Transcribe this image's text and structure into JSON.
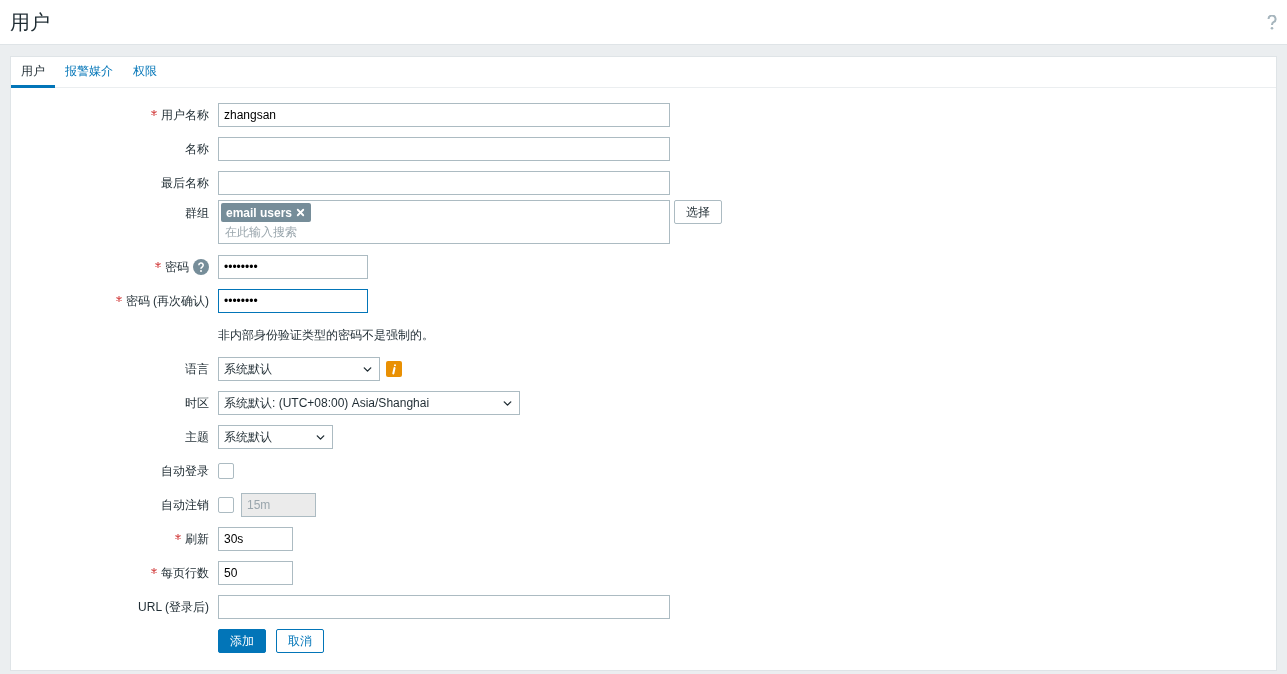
{
  "header": {
    "title": "用户"
  },
  "tabs": [
    {
      "label": "用户",
      "selected": true
    },
    {
      "label": "报警媒介",
      "selected": false
    },
    {
      "label": "权限",
      "selected": false
    }
  ],
  "form": {
    "rows": [
      {
        "kind": "text",
        "label": "用户名称",
        "required": true,
        "value": "zhangsan",
        "focused": false
      },
      {
        "kind": "text",
        "label": "名称",
        "required": false,
        "value": "",
        "focused": false
      },
      {
        "kind": "text",
        "label": "最后名称",
        "required": false,
        "value": "",
        "focused": false
      },
      {
        "kind": "multiselect",
        "label": "群组",
        "required": false,
        "tags": [
          "email users"
        ],
        "placeholder": "在此输入搜索",
        "button": "选择"
      },
      {
        "kind": "text",
        "label": "密码",
        "required": true,
        "value": "••••••••",
        "focused": false
      },
      {
        "kind": "text",
        "label": "密码 (再次确认)",
        "required": true,
        "value": "••••••••",
        "focused": true
      },
      {
        "kind": "note",
        "text": "非内部身份验证类型的密码不是强制的。"
      },
      {
        "kind": "select",
        "label": "语言",
        "required": false,
        "value": "系统默认"
      },
      {
        "kind": "select",
        "label": "时区",
        "required": false,
        "value": "系统默认: (UTC+08:00) Asia/Shanghai"
      },
      {
        "kind": "select",
        "label": "主题",
        "required": false,
        "value": "系统默认"
      },
      {
        "kind": "checkbox",
        "label": "自动登录",
        "required": false,
        "checked": false
      },
      {
        "kind": "checkbox",
        "label": "自动注销",
        "required": false,
        "checked": false,
        "value": "15m",
        "disabled": true
      },
      {
        "kind": "text",
        "label": "刷新",
        "required": true,
        "value": "30s",
        "focused": false
      },
      {
        "kind": "text",
        "label": "每页行数",
        "required": true,
        "value": "50",
        "focused": false
      },
      {
        "kind": "text",
        "label": "URL (登录后)",
        "required": false,
        "value": "",
        "focused": false
      }
    ],
    "buttons": [
      {
        "label": "添加",
        "primary": true
      },
      {
        "label": "取消",
        "primary": false
      }
    ]
  }
}
